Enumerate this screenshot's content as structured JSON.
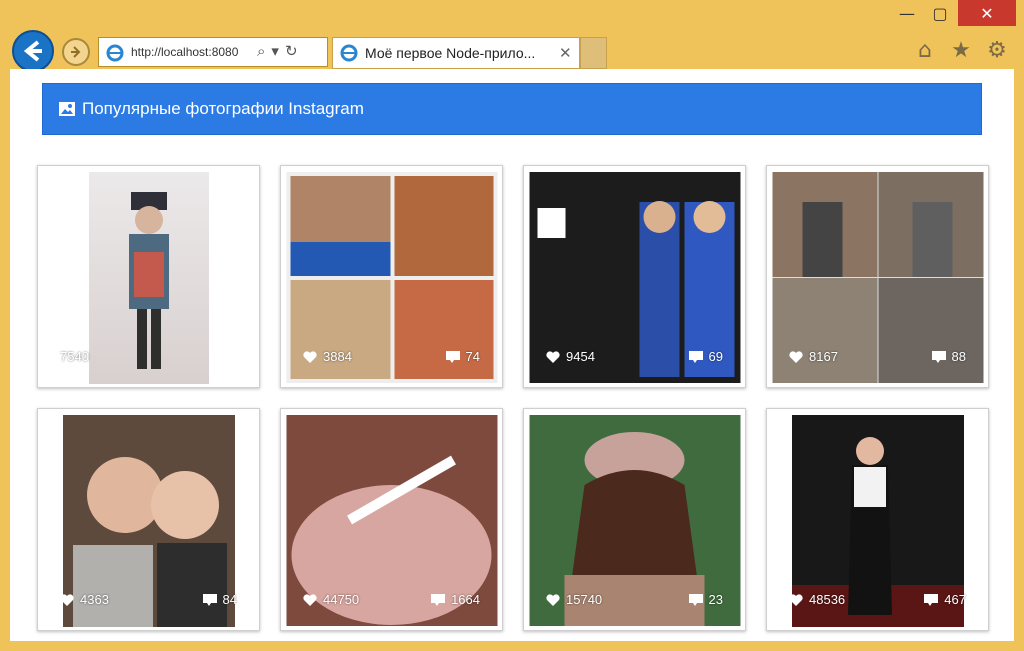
{
  "browser": {
    "address": "http://localhost:8080",
    "tab_title": "Моё первое Node-прило...",
    "minimize": "—",
    "maximize": "▢",
    "close": "✕",
    "tab_close": "✕",
    "home_icon": "home-icon",
    "star_icon": "star-icon",
    "gear_icon": "gear-icon"
  },
  "page": {
    "header_title": "Популярные фотографии Instagram"
  },
  "photos": [
    {
      "likes": "7540",
      "comments": ""
    },
    {
      "likes": "3884",
      "comments": "74"
    },
    {
      "likes": "9454",
      "comments": "69"
    },
    {
      "likes": "8167",
      "comments": "88"
    },
    {
      "likes": "4363",
      "comments": "84"
    },
    {
      "likes": "44750",
      "comments": "1664"
    },
    {
      "likes": "15740",
      "comments": "23"
    },
    {
      "likes": "48536",
      "comments": "467"
    }
  ],
  "colors": {
    "accent": "#2c7be5",
    "chrome": "#f0c25a"
  }
}
